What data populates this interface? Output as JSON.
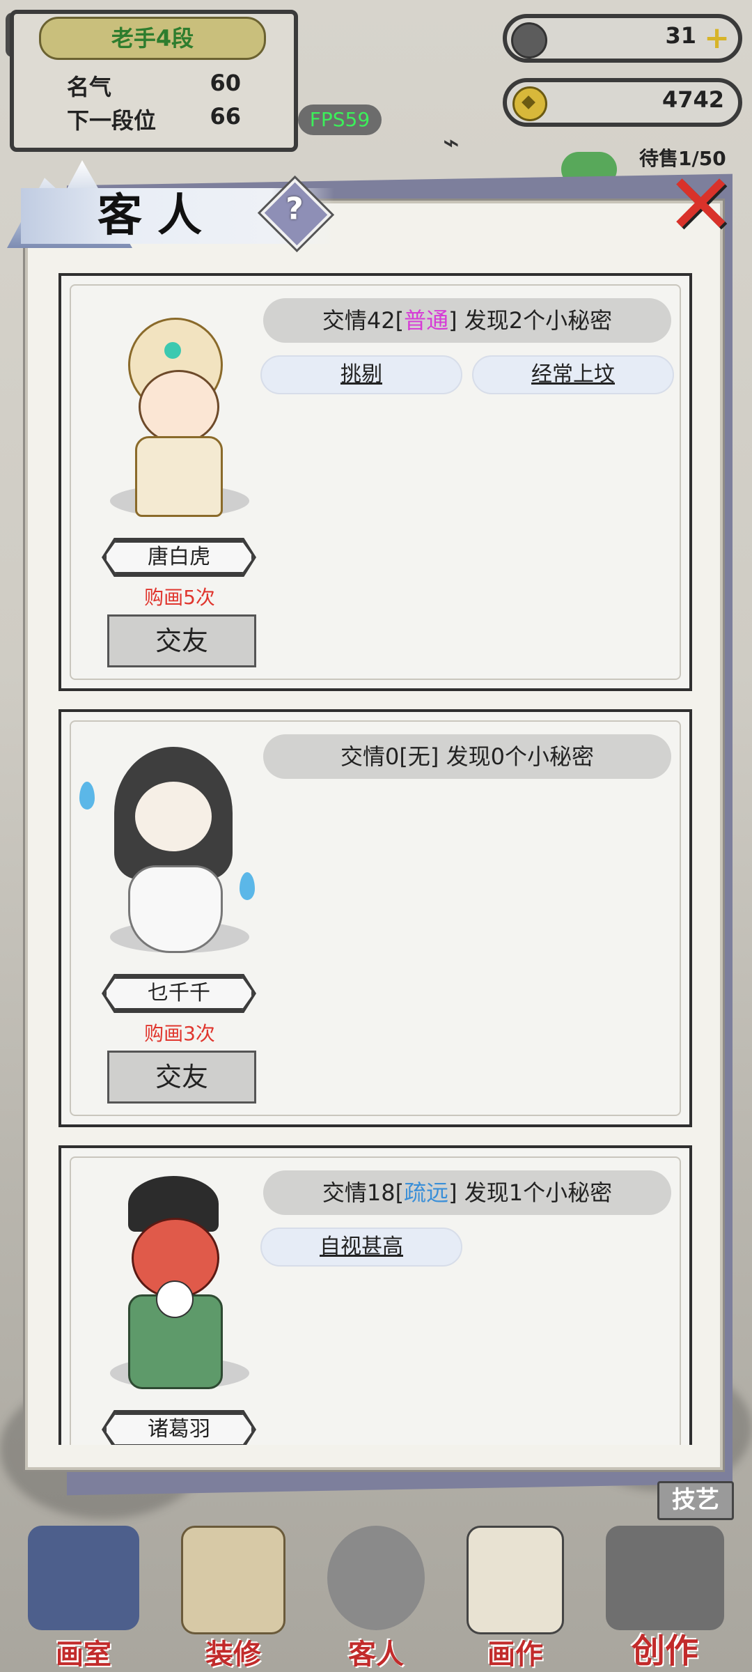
{
  "player": {
    "rank": "老手4段",
    "fame_label": "名气",
    "fame_value": "60",
    "next_label": "下一段位",
    "next_value": "66"
  },
  "fps": "FPS59",
  "currency": {
    "jade": "31",
    "coins": "4742"
  },
  "pending": "待售1/50",
  "panel": {
    "title": "客人",
    "help_icon": "?"
  },
  "guests": [
    {
      "relation_prefix": "交情42[",
      "relation_level": "普通",
      "relation_level_color": "#d63bd6",
      "relation_suffix": "] 发现2个小秘密",
      "tags": [
        "挑剔",
        "经常上坟"
      ],
      "name": "唐白虎",
      "purchases": "购画5次",
      "friend_button": "交友"
    },
    {
      "relation_prefix": "交情0[",
      "relation_level": "无",
      "relation_level_color": "#222222",
      "relation_suffix": "] 发现0个小秘密",
      "tags": [],
      "name": "乜千千",
      "purchases": "购画3次",
      "friend_button": "交友"
    },
    {
      "relation_prefix": "交情18[",
      "relation_level": "疏远",
      "relation_level_color": "#3a8fd8",
      "relation_suffix": "] 发现1个小秘密",
      "tags": [
        "自视甚高"
      ],
      "name": "诸葛羽"
    }
  ],
  "skill_button": "技艺",
  "nav": [
    {
      "label": "画室",
      "icon": "studio-icon"
    },
    {
      "label": "装修",
      "icon": "decor-icon"
    },
    {
      "label": "客人",
      "icon": "guest-icon"
    },
    {
      "label": "画作",
      "icon": "painting-icon"
    },
    {
      "label": "创作",
      "icon": "create-icon"
    }
  ]
}
